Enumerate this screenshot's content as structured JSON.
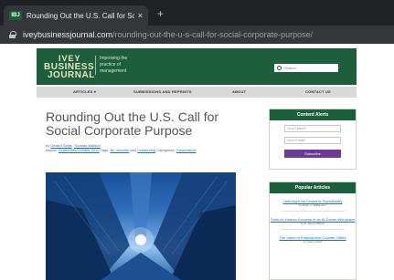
{
  "browser": {
    "tab_favicon": "IBJ",
    "tab_title": "Rounding Out the U.S. Call for So",
    "tab_close": "×",
    "new_tab": "+",
    "url_domain": "iveybusinessjournal.com",
    "url_path": "/rounding-out-the-u-s-call-for-social-corporate-purpose/"
  },
  "site": {
    "logo": [
      "IVEY",
      "BUSINESS",
      "JOURNAL"
    ],
    "tagline": "Improving the practice of management",
    "search_placeholder": "Search",
    "nav": [
      "ARTICLES ▾",
      "SUBMISSIONS AND REPRINTS",
      "ABOUT",
      "CONTACT US"
    ],
    "colors": {
      "brand_green": "#1d5f3c",
      "subscribe_purple": "#6b3a96",
      "link_blue": "#1f6fb8"
    }
  },
  "article": {
    "title": "Rounding Out the U.S. Call for Social Corporate Purpose",
    "byline_prefix": "by",
    "authors": [
      "Gerard Seijts",
      "Thomas Watson"
    ],
    "issue_label": "Issues",
    "issue": "September/October 2019",
    "tags_label": "Tags",
    "tags": [
      "Bu roundtre",
      "Leadership"
    ],
    "categories_label": "Categories",
    "category": "Governance"
  },
  "sidebar": {
    "alerts_heading": "Content Alerts",
    "name_placeholder": "Your Name*",
    "email_placeholder": "Your Email*",
    "subscribe_label": "Subscribe",
    "popular_heading": "Popular Articles",
    "popular": [
      {
        "title": "Learning from Huawei's Superfluidity",
        "by": "by Peter J. Williamson"
      },
      {
        "title": "Tools for Human Success in an AI-Driven Workplace",
        "by": "by E. James Wilson"
      },
      {
        "title": "The Value of Employment Counter Offers",
        "by": "by Carey Noble"
      }
    ]
  }
}
